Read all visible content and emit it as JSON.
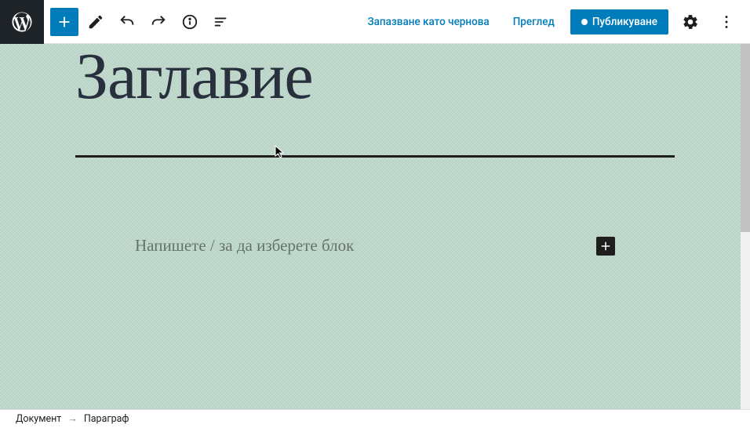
{
  "header": {
    "save_draft": "Запазване като чернова",
    "preview": "Преглед",
    "publish": "Публикуване"
  },
  "editor": {
    "title": "Заглавие",
    "paragraph_placeholder": "Напишете / за да изберете блок"
  },
  "breadcrumb": {
    "doc": "Документ",
    "block": "Параграф"
  },
  "colors": {
    "primary": "#007cba",
    "canvas_bg": "#b9d3c7"
  }
}
